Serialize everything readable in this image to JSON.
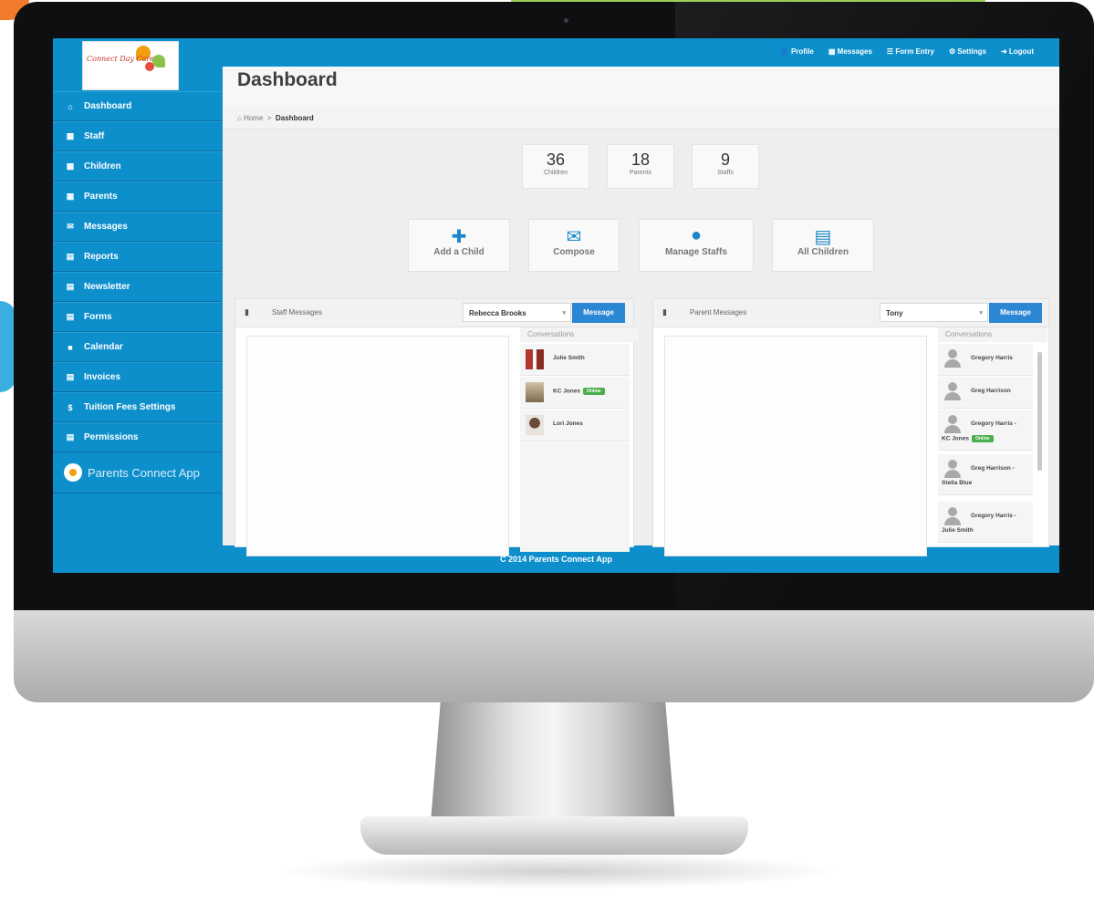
{
  "topnav": [
    {
      "icon": "user-icon",
      "label": "Profile"
    },
    {
      "icon": "messages-icon",
      "label": "Messages"
    },
    {
      "icon": "form-icon",
      "label": "Form Entry"
    },
    {
      "icon": "gear-icon",
      "label": "Settings"
    },
    {
      "icon": "logout-icon",
      "label": "Logout"
    }
  ],
  "logo": {
    "text": "Connect Day Care"
  },
  "sidebar": {
    "items": [
      {
        "icon": "home-icon",
        "label": "Dashboard"
      },
      {
        "icon": "table-icon",
        "label": "Staff"
      },
      {
        "icon": "table-icon",
        "label": "Children"
      },
      {
        "icon": "table-icon",
        "label": "Parents"
      },
      {
        "icon": "envelope-icon",
        "label": "Messages"
      },
      {
        "icon": "list-icon",
        "label": "Reports"
      },
      {
        "icon": "list-icon",
        "label": "Newsletter"
      },
      {
        "icon": "list-icon",
        "label": "Forms"
      },
      {
        "icon": "calendar-icon",
        "label": "Calendar"
      },
      {
        "icon": "list-icon",
        "label": "Invoices"
      },
      {
        "icon": "dollar-icon",
        "label": "Tuition Fees Settings"
      },
      {
        "icon": "list-icon",
        "label": "Permissions"
      }
    ],
    "app_label": "Parents Connect App"
  },
  "page": {
    "title": "Dashboard",
    "breadcrumb": {
      "home": "Home",
      "sep": ">",
      "current": "Dashboard"
    }
  },
  "stats": [
    {
      "value": "36",
      "label": "Children"
    },
    {
      "value": "18",
      "label": "Parents"
    },
    {
      "value": "9",
      "label": "Staffs"
    }
  ],
  "quick_actions": [
    {
      "icon": "add-child-icon",
      "label": "Add a Child"
    },
    {
      "icon": "envelope-icon",
      "label": "Compose"
    },
    {
      "icon": "person-icon",
      "label": "Manage Staffs"
    },
    {
      "icon": "list-icon",
      "label": "All Children"
    }
  ],
  "staff_panel": {
    "title": "Staff Messages",
    "select_value": "Rebecca Brooks",
    "button": "Message",
    "conversations_label": "Conversations",
    "conversations": [
      {
        "name": "Julie Smith",
        "online": ""
      },
      {
        "name": "KC Jones",
        "online": "Online"
      },
      {
        "name": "Lori Jones",
        "online": ""
      }
    ]
  },
  "parent_panel": {
    "title": "Parent Messages",
    "select_value": "Tony",
    "button": "Message",
    "conversations_label": "Conversations",
    "conversations": [
      {
        "name": "Gregory Harris",
        "sub": "",
        "online": ""
      },
      {
        "name": "Greg Harrison",
        "sub": "",
        "online": ""
      },
      {
        "name": "Gregory Harris -",
        "sub": "KC Jones",
        "online": "Online"
      },
      {
        "name": "Greg Harrison -",
        "sub": "Stella Blue",
        "online": ""
      },
      {
        "name": "Gregory Harris -",
        "sub": "Julie Smith",
        "online": ""
      }
    ]
  },
  "footer": "C 2014 Parents Connect App"
}
